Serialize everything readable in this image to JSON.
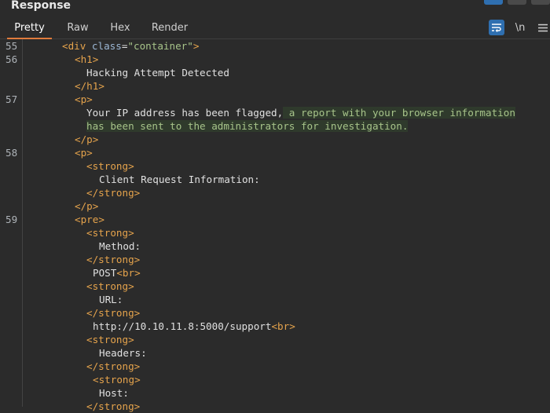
{
  "panel": {
    "title": "Response"
  },
  "tabs": [
    {
      "label": "Pretty",
      "active": true
    },
    {
      "label": "Raw",
      "active": false
    },
    {
      "label": "Hex",
      "active": false
    },
    {
      "label": "Render",
      "active": false
    }
  ],
  "toolbar": {
    "newline_label": "\\n",
    "wrap_icon": "wrap-lines-icon",
    "menu_icon": "hamburger-menu-icon"
  },
  "colors": {
    "accent_tab": "#e07b3c",
    "active_button": "#2f6fb0",
    "tag": "#e5a34c",
    "attr": "#9cb7d4",
    "string": "#a7c48a"
  },
  "gutter": [
    "55",
    "56",
    "57",
    "58",
    "59"
  ],
  "code": {
    "l55_open": "<div ",
    "l55_attr": "class",
    "l55_eq": "=",
    "l55_val": "\"container\"",
    "l55_close": ">",
    "h1_open": "<h1>",
    "h1_text": "Hacking Attempt Detected",
    "h1_close": "</h1>",
    "p_open": "<p>",
    "p_text_a": "Your IP address has been flagged,",
    "p_text_b": " a report with your browser information",
    "p_text_c": "has been sent to the administrators for investigation.",
    "p_close": "</p>",
    "strong_open": "<strong>",
    "strong_close": "</strong>",
    "client_info": "Client Request Information:",
    "pre_open": "<pre>",
    "method_label": "Method:",
    "method_value": "POST",
    "br": "<br>",
    "url_label": "URL:",
    "url_value": "http://10.10.11.8:5000/support",
    "headers_label": "Headers:",
    "host_label": "Host:"
  }
}
